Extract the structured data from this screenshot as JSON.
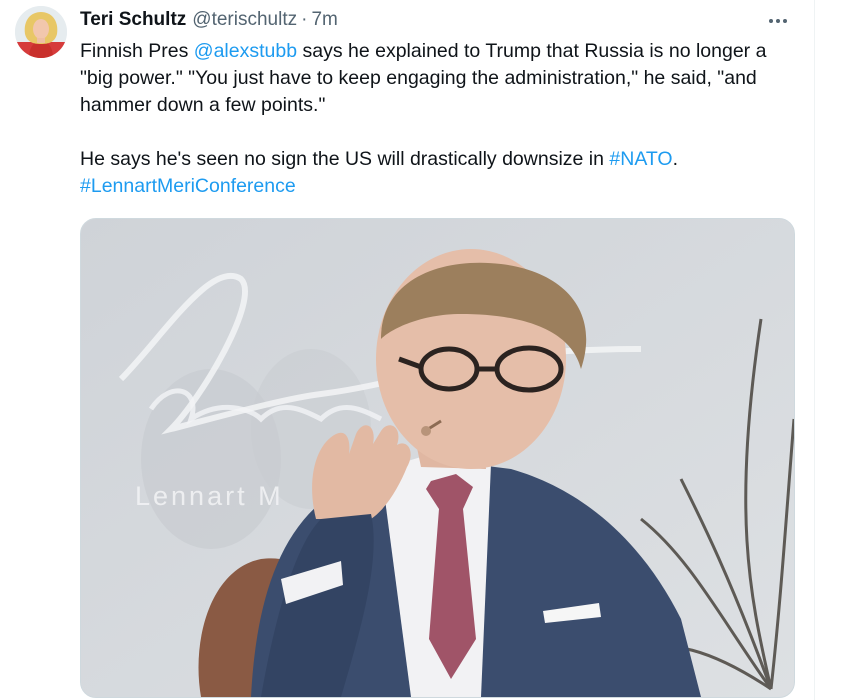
{
  "tweet": {
    "author": {
      "display_name": "Teri Schultz",
      "handle": "@terischultz",
      "separator": "·",
      "time_ago": "7m"
    },
    "paragraph1": {
      "prefix": "Finnish Pres ",
      "mention": "@alexstubb",
      "suffix": " says he explained to Trump that Russia is no longer a \"big power.\" \"You just have to keep engaging the administration,\" he said, \"and hammer down a few points.\""
    },
    "paragraph2": {
      "prefix": "He says he's seen no sign the US will drastically downsize in ",
      "hashtag1": "#NATO",
      "punct": ".",
      "hashtag2": "#LennartMeriConference"
    },
    "media": {
      "backdrop_text": "Lennart M"
    }
  },
  "colors": {
    "link": "#1d9bf0",
    "text": "#0f1419",
    "secondary": "#536471",
    "border": "#cfd9de"
  },
  "icons": [
    "avatar",
    "more-options-icon"
  ]
}
